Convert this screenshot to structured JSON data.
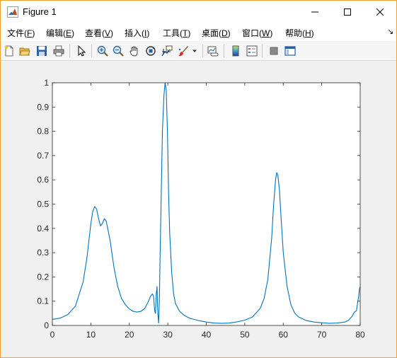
{
  "window": {
    "title": "Figure 1",
    "accent_border": "#f0a030"
  },
  "menubar": {
    "items": [
      {
        "label": "文件(",
        "key": "F",
        "tail": ")"
      },
      {
        "label": "编辑(",
        "key": "E",
        "tail": ")"
      },
      {
        "label": "查看(",
        "key": "V",
        "tail": ")"
      },
      {
        "label": "插入(",
        "key": "I",
        "tail": ")"
      },
      {
        "label": "工具(",
        "key": "T",
        "tail": ")"
      },
      {
        "label": "桌面(",
        "key": "D",
        "tail": ")"
      },
      {
        "label": "窗口(",
        "key": "W",
        "tail": ")"
      },
      {
        "label": "帮助(",
        "key": "H",
        "tail": ")"
      }
    ],
    "overflow_glyph": "↘"
  },
  "toolbar": {
    "icons": [
      "new-figure-icon",
      "open-file-icon",
      "save-icon",
      "print-icon",
      "pointer-icon",
      "zoom-in-icon",
      "zoom-out-icon",
      "pan-hand-icon",
      "rotate-3d-icon",
      "data-cursor-icon",
      "brush-icon",
      "brush-dropdown-icon",
      "link-plot-icon",
      "colorbar-icon",
      "legend-icon",
      "hide-plot-tools-icon",
      "show-plot-tools-icon"
    ]
  },
  "chart_data": {
    "type": "line",
    "title": "",
    "xlabel": "",
    "ylabel": "",
    "xlim": [
      0,
      80
    ],
    "ylim": [
      0,
      1
    ],
    "xticks": [
      0,
      10,
      20,
      30,
      40,
      50,
      60,
      70,
      80
    ],
    "yticks": [
      0,
      0.1,
      0.2,
      0.3,
      0.4,
      0.5,
      0.6,
      0.7,
      0.8,
      0.9,
      1
    ],
    "grid": false,
    "line_color": "#0072bd",
    "series": [
      {
        "x": [
          0,
          2,
          4,
          6,
          8,
          9,
          10,
          10.5,
          11,
          11.5,
          12,
          12.5,
          13,
          13.5,
          14,
          15,
          16,
          17,
          18,
          19,
          20,
          21,
          22,
          23,
          24,
          25,
          25.5,
          26,
          26.3,
          26.6,
          26.8,
          27,
          27.2,
          27.4,
          27.6,
          27.8,
          28,
          28.3,
          28.6,
          29,
          29.3,
          29.6,
          29.9,
          30.2,
          30.5,
          31,
          31.5,
          32,
          33,
          34,
          35,
          36,
          38,
          40,
          42,
          44,
          46,
          48,
          50,
          52,
          54,
          55,
          56,
          57,
          57.5,
          58,
          58.3,
          58.6,
          59,
          59.5,
          60,
          61,
          62,
          63,
          64,
          66,
          68,
          70,
          72,
          74,
          76,
          77,
          78,
          78.5,
          79,
          79.3,
          79.6,
          79.8,
          80
        ],
        "y": [
          0.025,
          0.03,
          0.045,
          0.08,
          0.18,
          0.28,
          0.42,
          0.47,
          0.49,
          0.48,
          0.44,
          0.41,
          0.42,
          0.44,
          0.43,
          0.35,
          0.24,
          0.16,
          0.11,
          0.085,
          0.068,
          0.058,
          0.055,
          0.058,
          0.07,
          0.1,
          0.12,
          0.13,
          0.12,
          0.06,
          0.05,
          0.13,
          0.16,
          0.05,
          0.01,
          0.1,
          0.3,
          0.55,
          0.8,
          0.95,
          1.0,
          0.97,
          0.8,
          0.55,
          0.38,
          0.22,
          0.13,
          0.09,
          0.06,
          0.045,
          0.035,
          0.028,
          0.02,
          0.014,
          0.01,
          0.009,
          0.01,
          0.015,
          0.022,
          0.035,
          0.07,
          0.11,
          0.19,
          0.36,
          0.5,
          0.6,
          0.63,
          0.62,
          0.56,
          0.43,
          0.3,
          0.16,
          0.085,
          0.05,
          0.035,
          0.02,
          0.014,
          0.011,
          0.009,
          0.01,
          0.014,
          0.022,
          0.04,
          0.055,
          0.06,
          0.09,
          0.12,
          0.15,
          0.16
        ]
      }
    ]
  }
}
